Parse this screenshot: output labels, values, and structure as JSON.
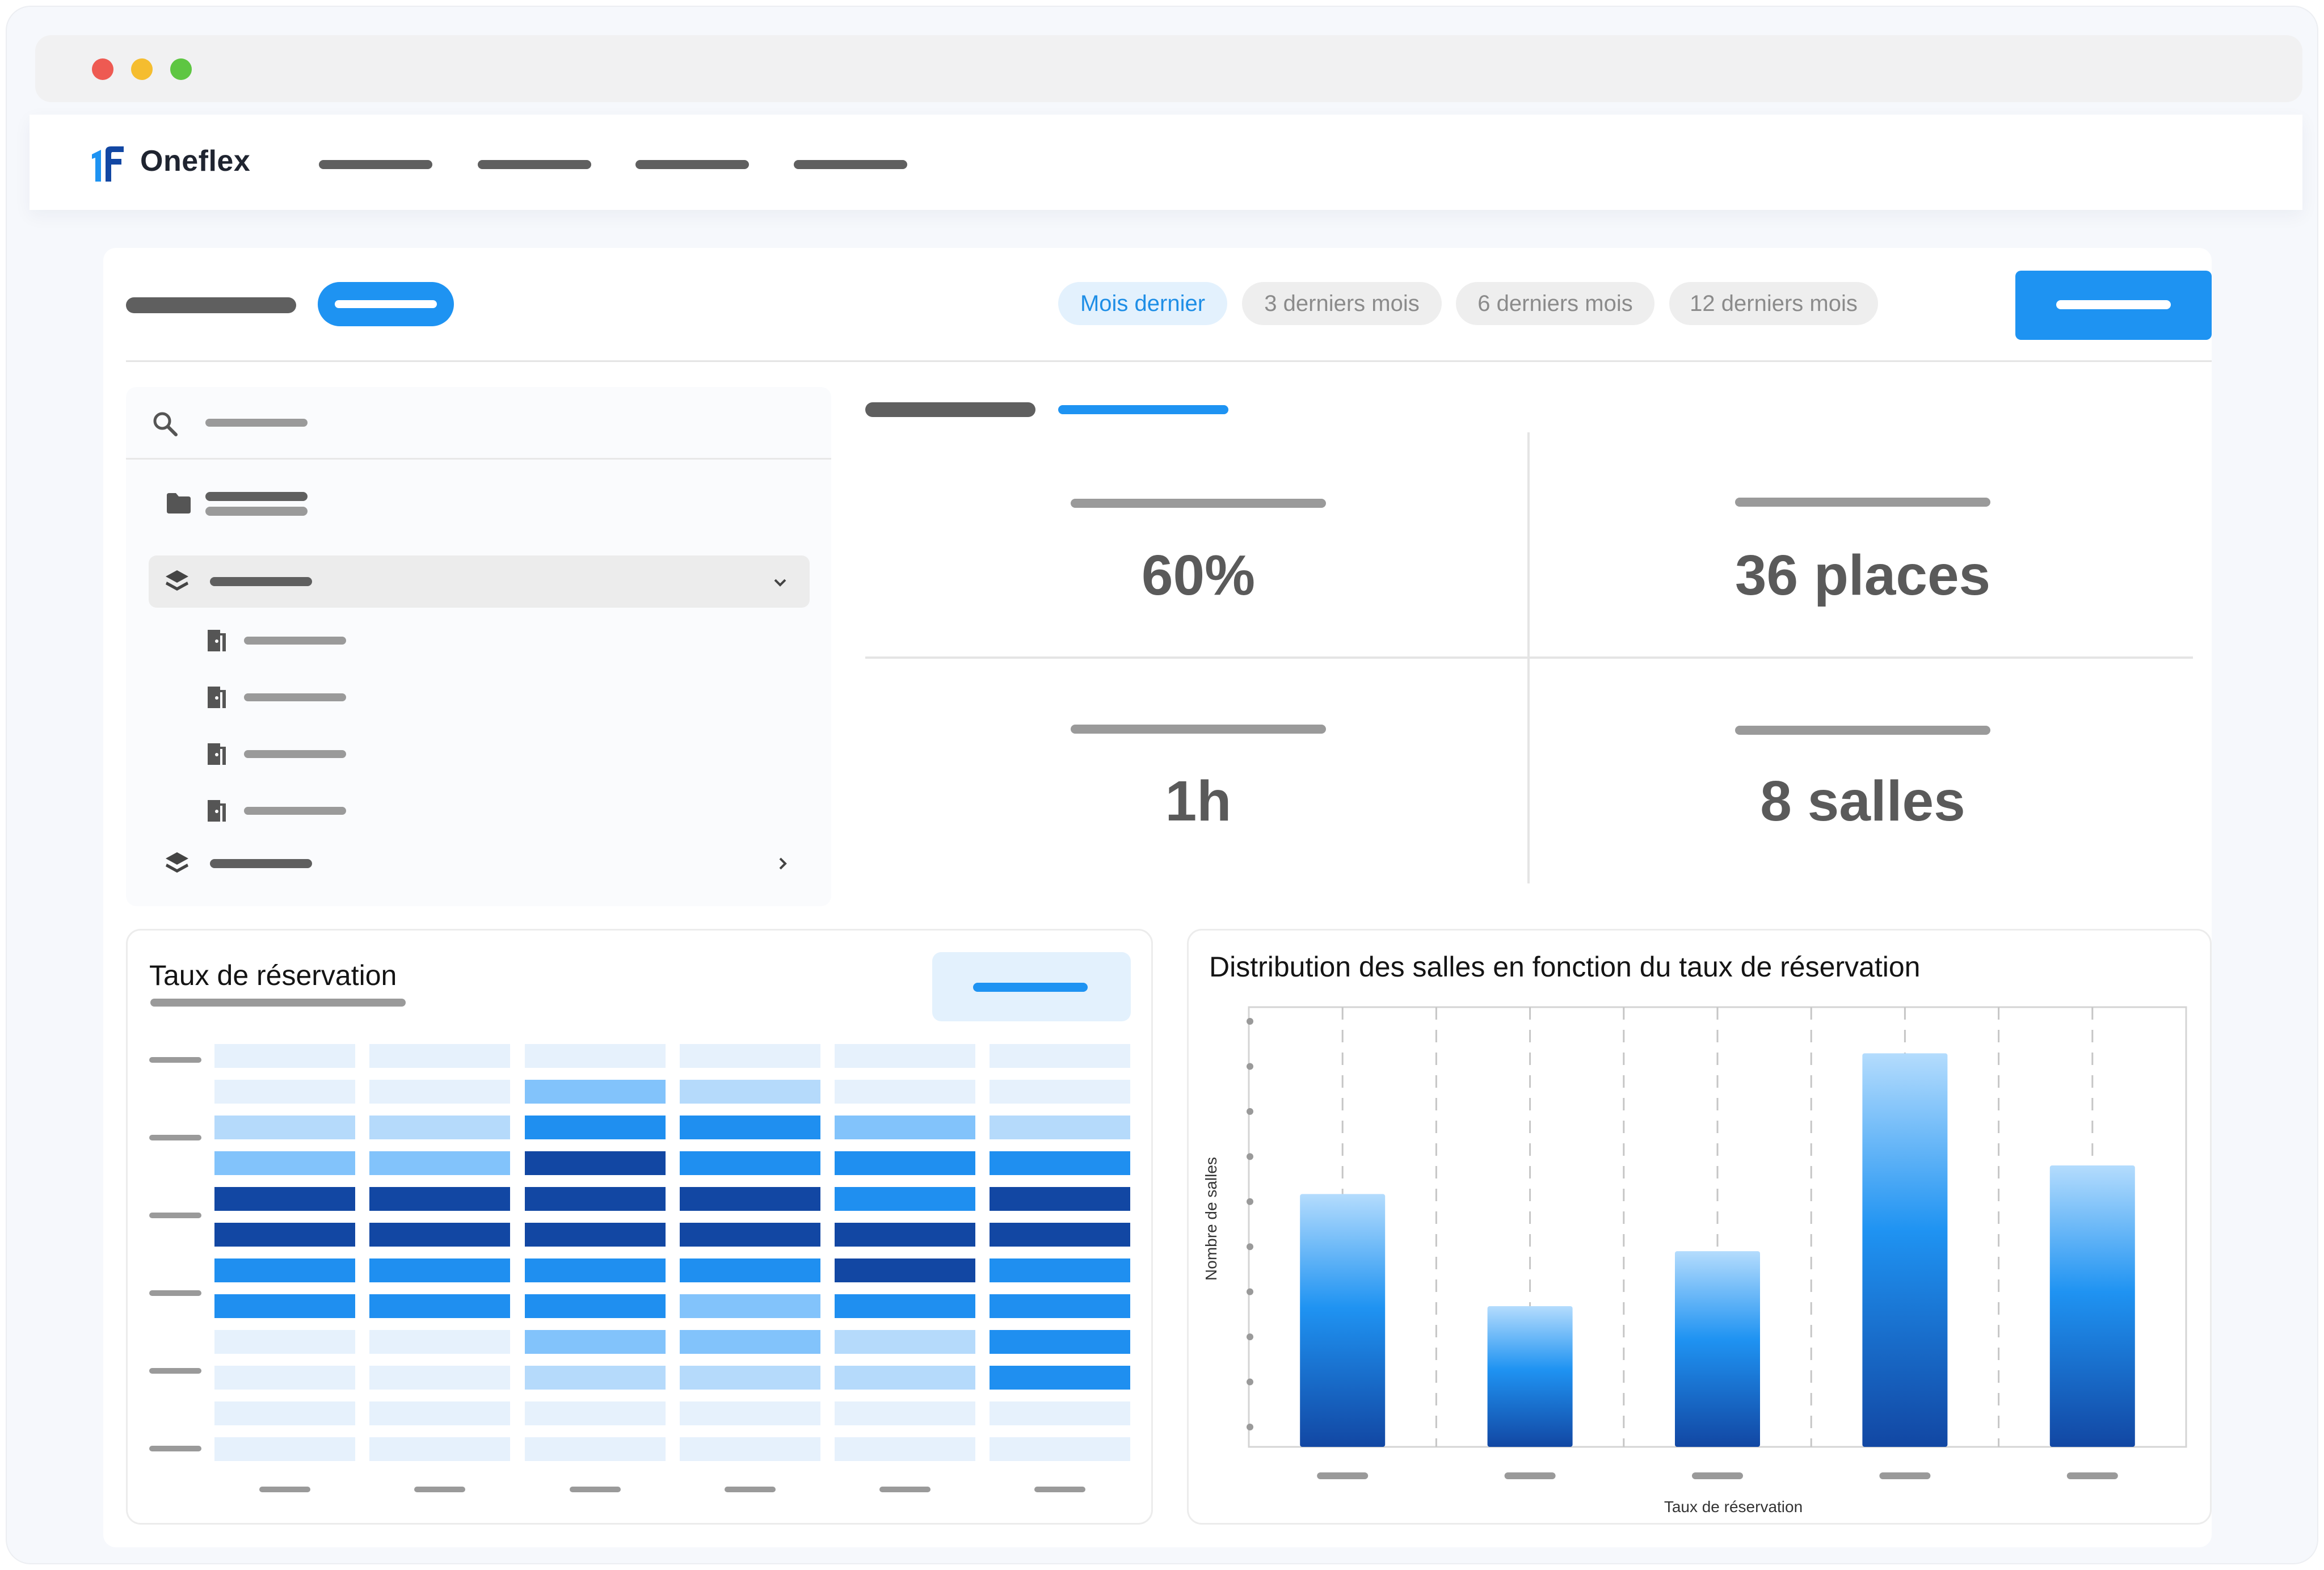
{
  "app": {
    "name": "Oneflex"
  },
  "period_tabs": [
    {
      "label": "Mois dernier",
      "active": true
    },
    {
      "label": "3 derniers mois",
      "active": false
    },
    {
      "label": "6 derniers mois",
      "active": false
    },
    {
      "label": "12 derniers mois",
      "active": false
    }
  ],
  "kpis": [
    {
      "value": "60%"
    },
    {
      "value": "36 places"
    },
    {
      "value": "1h"
    },
    {
      "value": "8 salles"
    }
  ],
  "heatmap": {
    "title": "Taux de réservation",
    "levels": [
      [
        0,
        0,
        0,
        0,
        0,
        0
      ],
      [
        0,
        0,
        2,
        1,
        0,
        0
      ],
      [
        1,
        1,
        3,
        3,
        2,
        1
      ],
      [
        2,
        2,
        4,
        3,
        3,
        3
      ],
      [
        4,
        4,
        4,
        4,
        3,
        4
      ],
      [
        4,
        4,
        4,
        4,
        4,
        4
      ],
      [
        3,
        3,
        3,
        3,
        4,
        3
      ],
      [
        3,
        3,
        3,
        2,
        3,
        3
      ],
      [
        0,
        0,
        2,
        2,
        1,
        3
      ],
      [
        0,
        0,
        1,
        1,
        1,
        3
      ],
      [
        0,
        0,
        0,
        0,
        0,
        0
      ],
      [
        0,
        0,
        0,
        0,
        0,
        0
      ]
    ],
    "palette": [
      "#e6f1fc",
      "#b5dafb",
      "#82c3fb",
      "#1f8ff0",
      "#1247a3"
    ]
  },
  "chart_data": {
    "type": "bar",
    "title": "Distribution des salles en fonction du taux de réservation",
    "xlabel": "Taux de réservation",
    "ylabel": "Nombre de salles",
    "values": [
      5.75,
      3.2,
      4.45,
      8.95,
      6.4
    ],
    "ylim": [
      0,
      10
    ],
    "grid": "vertical-dashed"
  },
  "icons": {
    "search": "search-icon",
    "folder": "folder-icon",
    "layers": "layers-icon",
    "door": "door-icon",
    "chevron_down": "chevron-down-icon",
    "chevron_right": "chevron-right-icon"
  },
  "colors": {
    "accent": "#1e93f2",
    "dark": "#1247a3",
    "muted": "#9a9a9a"
  }
}
